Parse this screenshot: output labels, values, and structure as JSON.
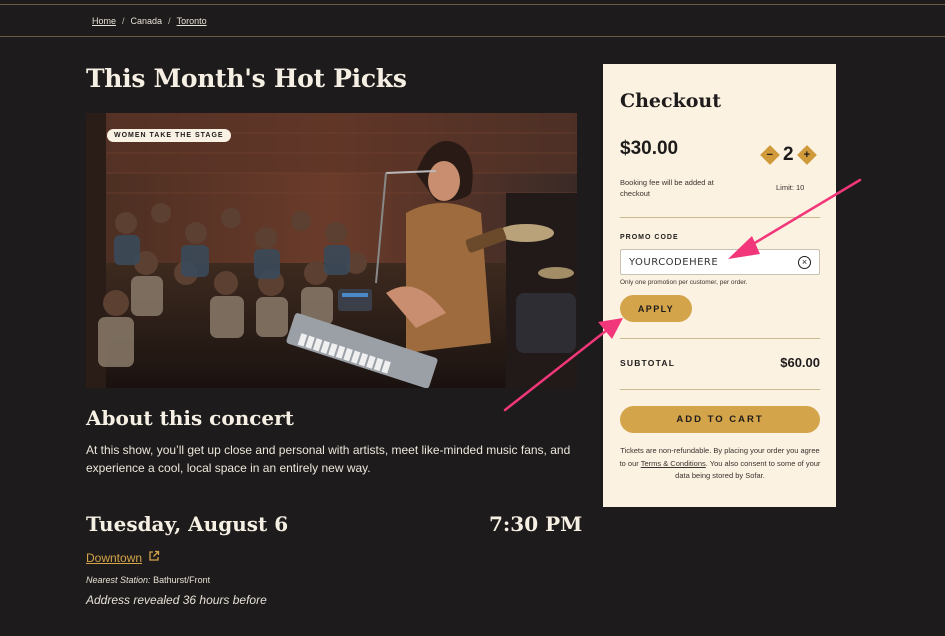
{
  "breadcrumb": {
    "home": "Home",
    "country": "Canada",
    "city": "Toronto",
    "separator": "/"
  },
  "page_title": "This Month's Hot Picks",
  "hero": {
    "badge": "WOMEN TAKE THE STAGE",
    "image_description_icon": "concert-photo"
  },
  "about": {
    "title": "About this concert",
    "text": "At this show, you’ll get up close and personal with artists, meet like-minded music fans, and experience a cool, local space in an entirely new way."
  },
  "event": {
    "date": "Tuesday, August 6",
    "time": "7:30 PM",
    "venue": "Downtown",
    "station_label": "Nearest Station:",
    "station_value": "Bathurst/Front",
    "address_note": "Address revealed 36 hours before"
  },
  "checkout": {
    "title": "Checkout",
    "price": "$30.00",
    "quantity": "2",
    "minus": "−",
    "plus": "+",
    "fee_note": "Booking fee will be added at checkout",
    "limit": "Limit: 10",
    "promo_label": "PROMO CODE",
    "promo_value": "YOURCODEHERE",
    "promo_note": "Only one promotion per customer, per order.",
    "apply": "APPLY",
    "subtotal_label": "SUBTOTAL",
    "subtotal_value": "$60.00",
    "add_to_cart": "ADD TO CART",
    "tos_prefix": "Tickets are non-refundable. By placing your order you agree to our ",
    "tos_link": "Terms & Conditions",
    "tos_suffix": ". You also consent to some of your data being stored by Sofar."
  },
  "colors": {
    "background": "#1d1b1b",
    "panel": "#fcf2e1",
    "accent": "#d4a44a",
    "annotation_arrow": "#f2367a"
  }
}
